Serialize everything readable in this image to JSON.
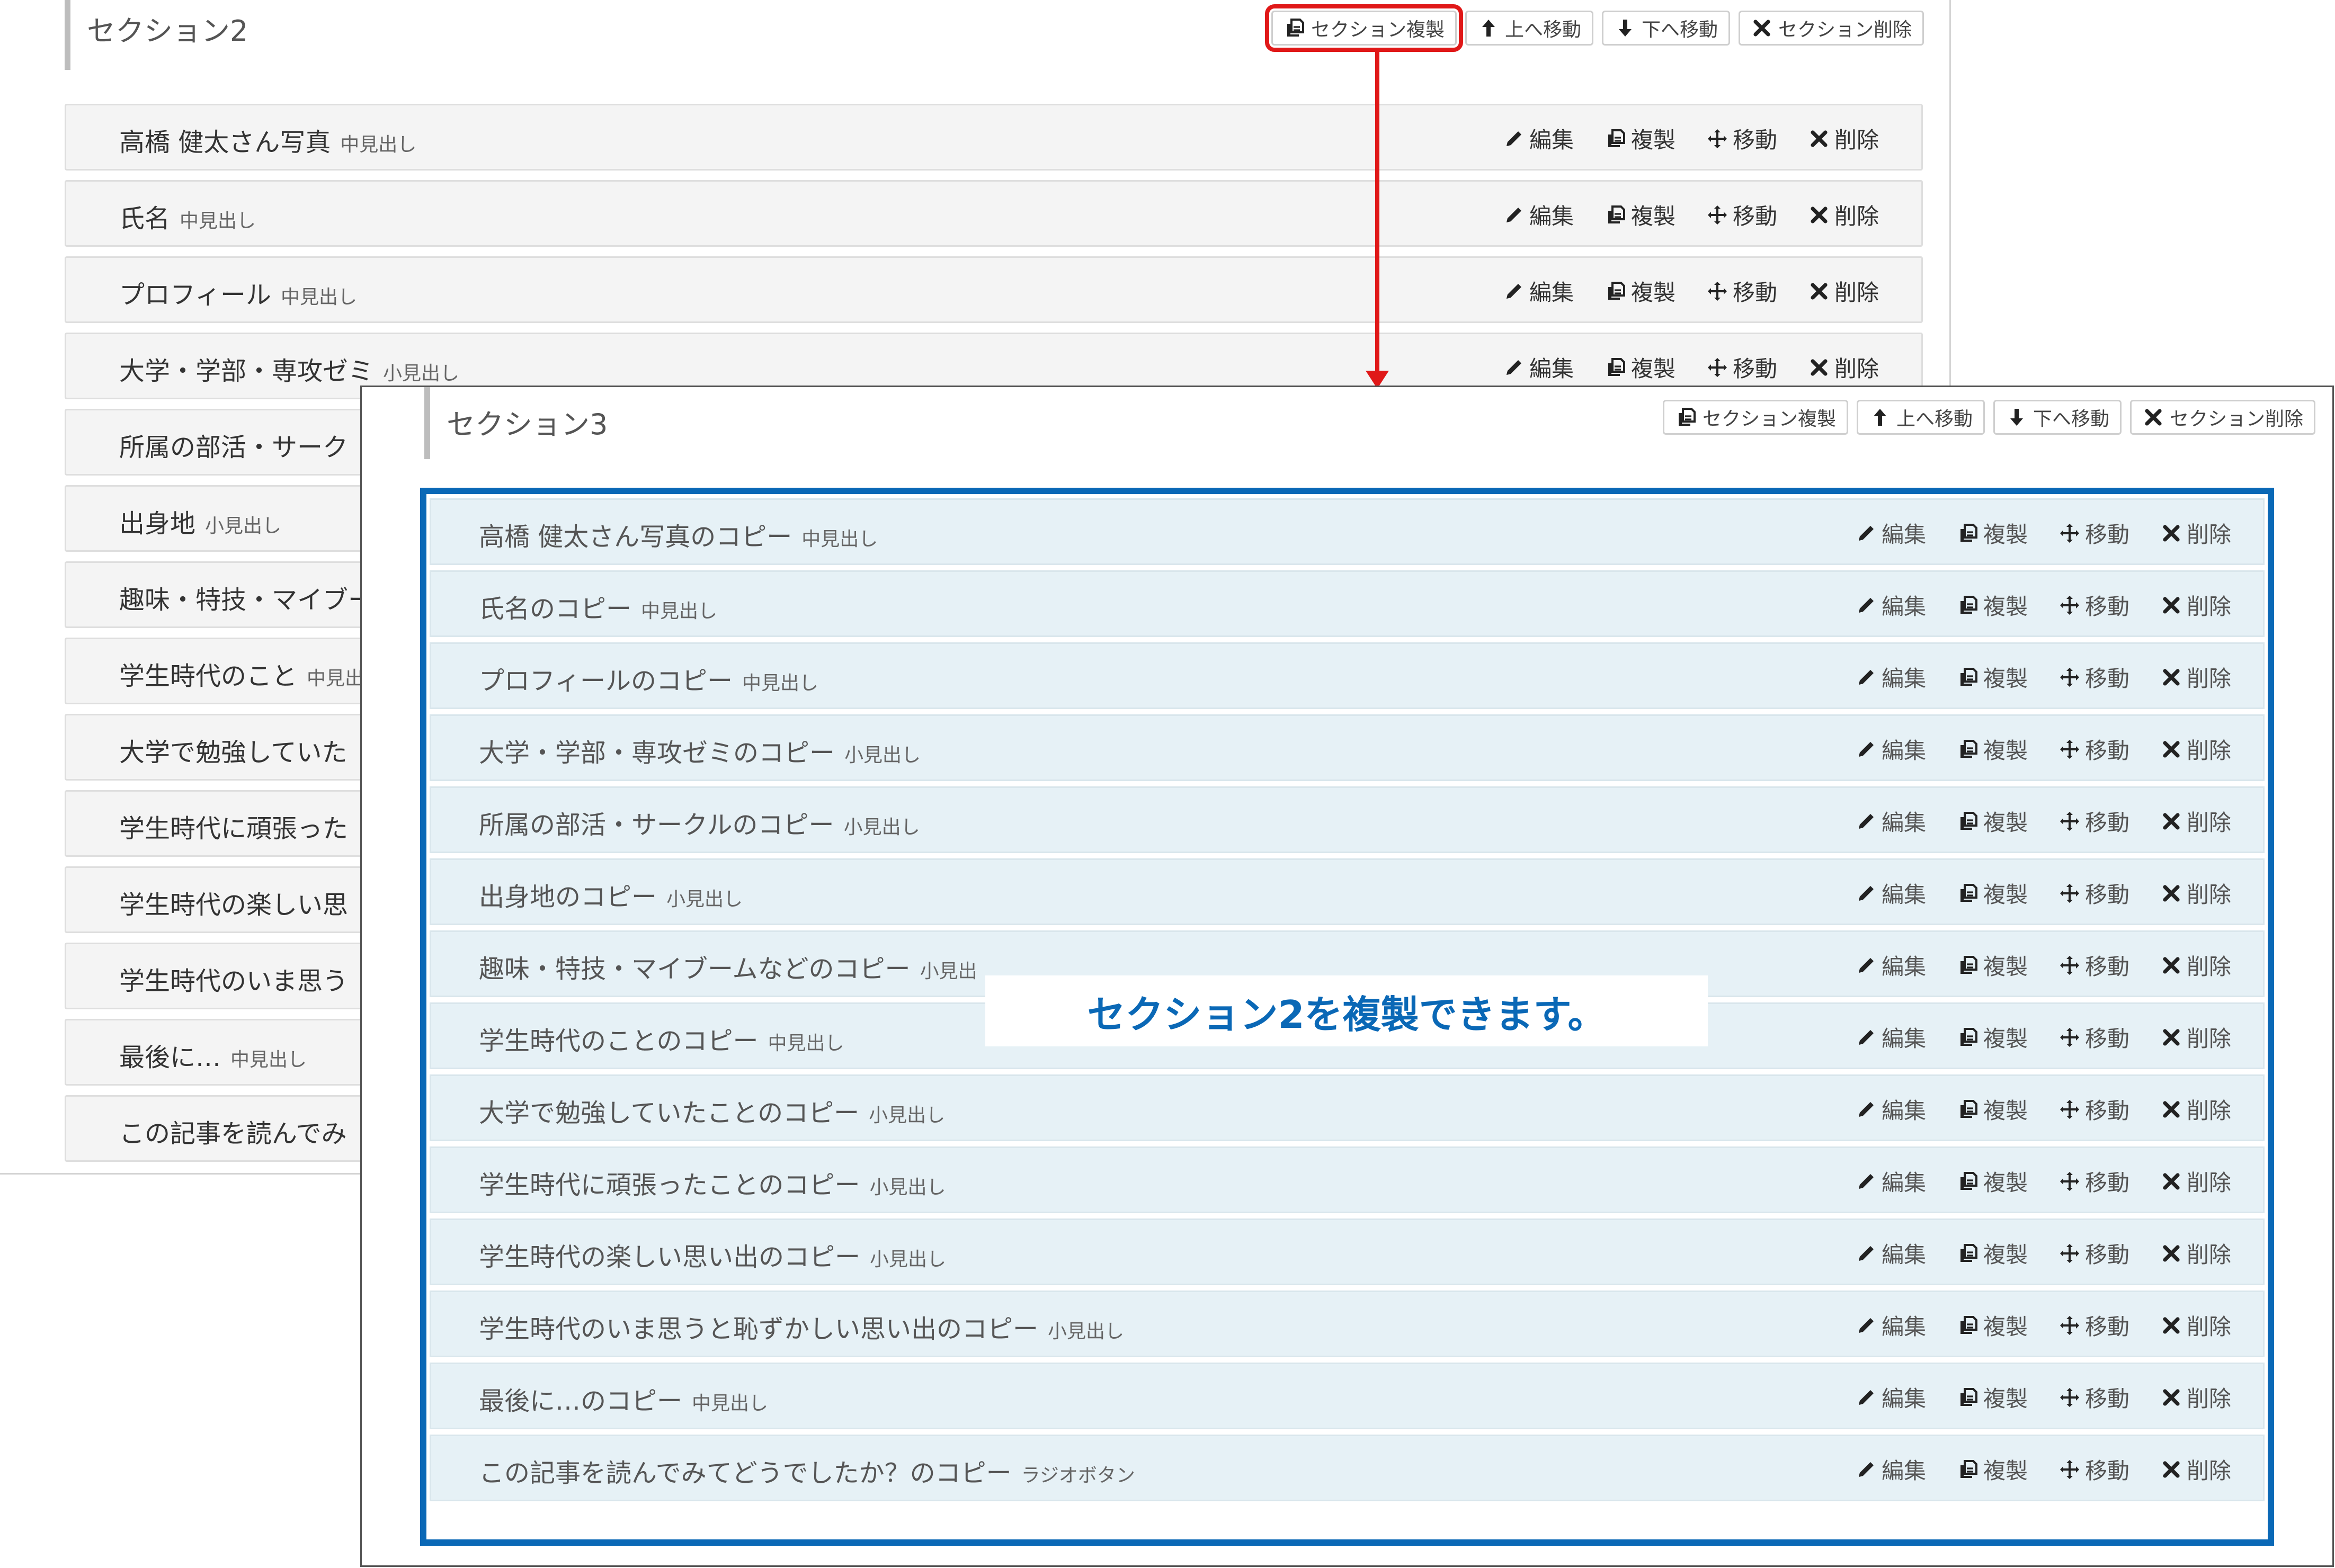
{
  "section_back": {
    "title": "セクション2",
    "actions": [
      "セクション複製",
      "上へ移動",
      "下へ移動",
      "セクション削除"
    ],
    "rows": [
      {
        "label": "高橋 健太さん写真",
        "tag": "中見出し"
      },
      {
        "label": "氏名",
        "tag": "中見出し"
      },
      {
        "label": "プロフィール",
        "tag": "中見出し"
      },
      {
        "label": "大学・学部・専攻ゼミ",
        "tag": "小見出し"
      },
      {
        "label": "所属の部活・サーク",
        "tag": ""
      },
      {
        "label": "出身地",
        "tag": "小見出し"
      },
      {
        "label": "趣味・特技・マイブー",
        "tag": ""
      },
      {
        "label": "学生時代のこと",
        "tag": "中見出"
      },
      {
        "label": "大学で勉強していた",
        "tag": ""
      },
      {
        "label": "学生時代に頑張った",
        "tag": ""
      },
      {
        "label": "学生時代の楽しい思",
        "tag": ""
      },
      {
        "label": "学生時代のいま思う",
        "tag": ""
      },
      {
        "label": "最後に…",
        "tag": "中見出し"
      },
      {
        "label": "この記事を読んでみ",
        "tag": ""
      }
    ]
  },
  "section_front": {
    "title": "セクション3",
    "actions": [
      "セクション複製",
      "上へ移動",
      "下へ移動",
      "セクション削除"
    ],
    "rows": [
      {
        "label": "高橋 健太さん写真のコピー",
        "tag": "中見出し"
      },
      {
        "label": "氏名のコピー",
        "tag": "中見出し"
      },
      {
        "label": "プロフィールのコピー",
        "tag": "中見出し"
      },
      {
        "label": "大学・学部・専攻ゼミのコピー",
        "tag": "小見出し"
      },
      {
        "label": "所属の部活・サークルのコピー",
        "tag": "小見出し"
      },
      {
        "label": "出身地のコピー",
        "tag": "小見出し"
      },
      {
        "label": "趣味・特技・マイブームなどのコピー",
        "tag": "小見出"
      },
      {
        "label": "学生時代のことのコピー",
        "tag": "中見出し"
      },
      {
        "label": "大学で勉強していたことのコピー",
        "tag": "小見出し"
      },
      {
        "label": "学生時代に頑張ったことのコピー",
        "tag": "小見出し"
      },
      {
        "label": "学生時代の楽しい思い出のコピー",
        "tag": "小見出し"
      },
      {
        "label": "学生時代のいま思うと恥ずかしい思い出のコピー",
        "tag": "小見出し"
      },
      {
        "label": "最後に…のコピー",
        "tag": "中見出し"
      },
      {
        "label": "この記事を読んでみてどうでしたか？のコピー",
        "tag": "ラジオボタン"
      }
    ]
  },
  "row_actions": [
    "編集",
    "複製",
    "移動",
    "削除"
  ],
  "callout": "セクション2を複製できます。",
  "colors": {
    "highlight_red": "#e01818",
    "highlight_blue": "#0a68b6",
    "copied_row_bg": "#e6f1f6"
  },
  "icons": {
    "section_actions": [
      "copy-icon",
      "arrow-up-icon",
      "arrow-down-icon",
      "close-icon"
    ],
    "row_actions": [
      "pencil-icon",
      "copy-icon",
      "move-icon",
      "close-icon"
    ]
  }
}
